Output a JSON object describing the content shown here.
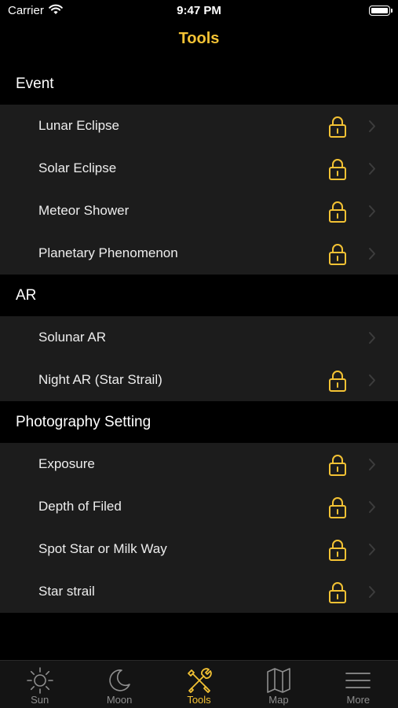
{
  "status": {
    "carrier": "Carrier",
    "time": "9:47 PM"
  },
  "nav": {
    "title": "Tools"
  },
  "accent": "#f3c234",
  "sections": [
    {
      "title": "Event",
      "rows": [
        {
          "label": "Lunar Eclipse",
          "locked": true
        },
        {
          "label": "Solar Eclipse",
          "locked": true
        },
        {
          "label": "Meteor Shower",
          "locked": true
        },
        {
          "label": "Planetary Phenomenon",
          "locked": true
        }
      ]
    },
    {
      "title": "AR",
      "rows": [
        {
          "label": "Solunar AR",
          "locked": false
        },
        {
          "label": "Night AR (Star Strail)",
          "locked": true
        }
      ]
    },
    {
      "title": "Photography Setting",
      "rows": [
        {
          "label": "Exposure",
          "locked": true
        },
        {
          "label": "Depth of Filed",
          "locked": true
        },
        {
          "label": "Spot Star or Milk Way",
          "locked": true
        },
        {
          "label": "Star strail",
          "locked": true
        }
      ]
    }
  ],
  "tabs": [
    {
      "label": "Sun",
      "icon": "sun-icon"
    },
    {
      "label": "Moon",
      "icon": "moon-icon"
    },
    {
      "label": "Tools",
      "icon": "tools-icon",
      "active": true
    },
    {
      "label": "Map",
      "icon": "map-icon"
    },
    {
      "label": "More",
      "icon": "menu-icon"
    }
  ]
}
